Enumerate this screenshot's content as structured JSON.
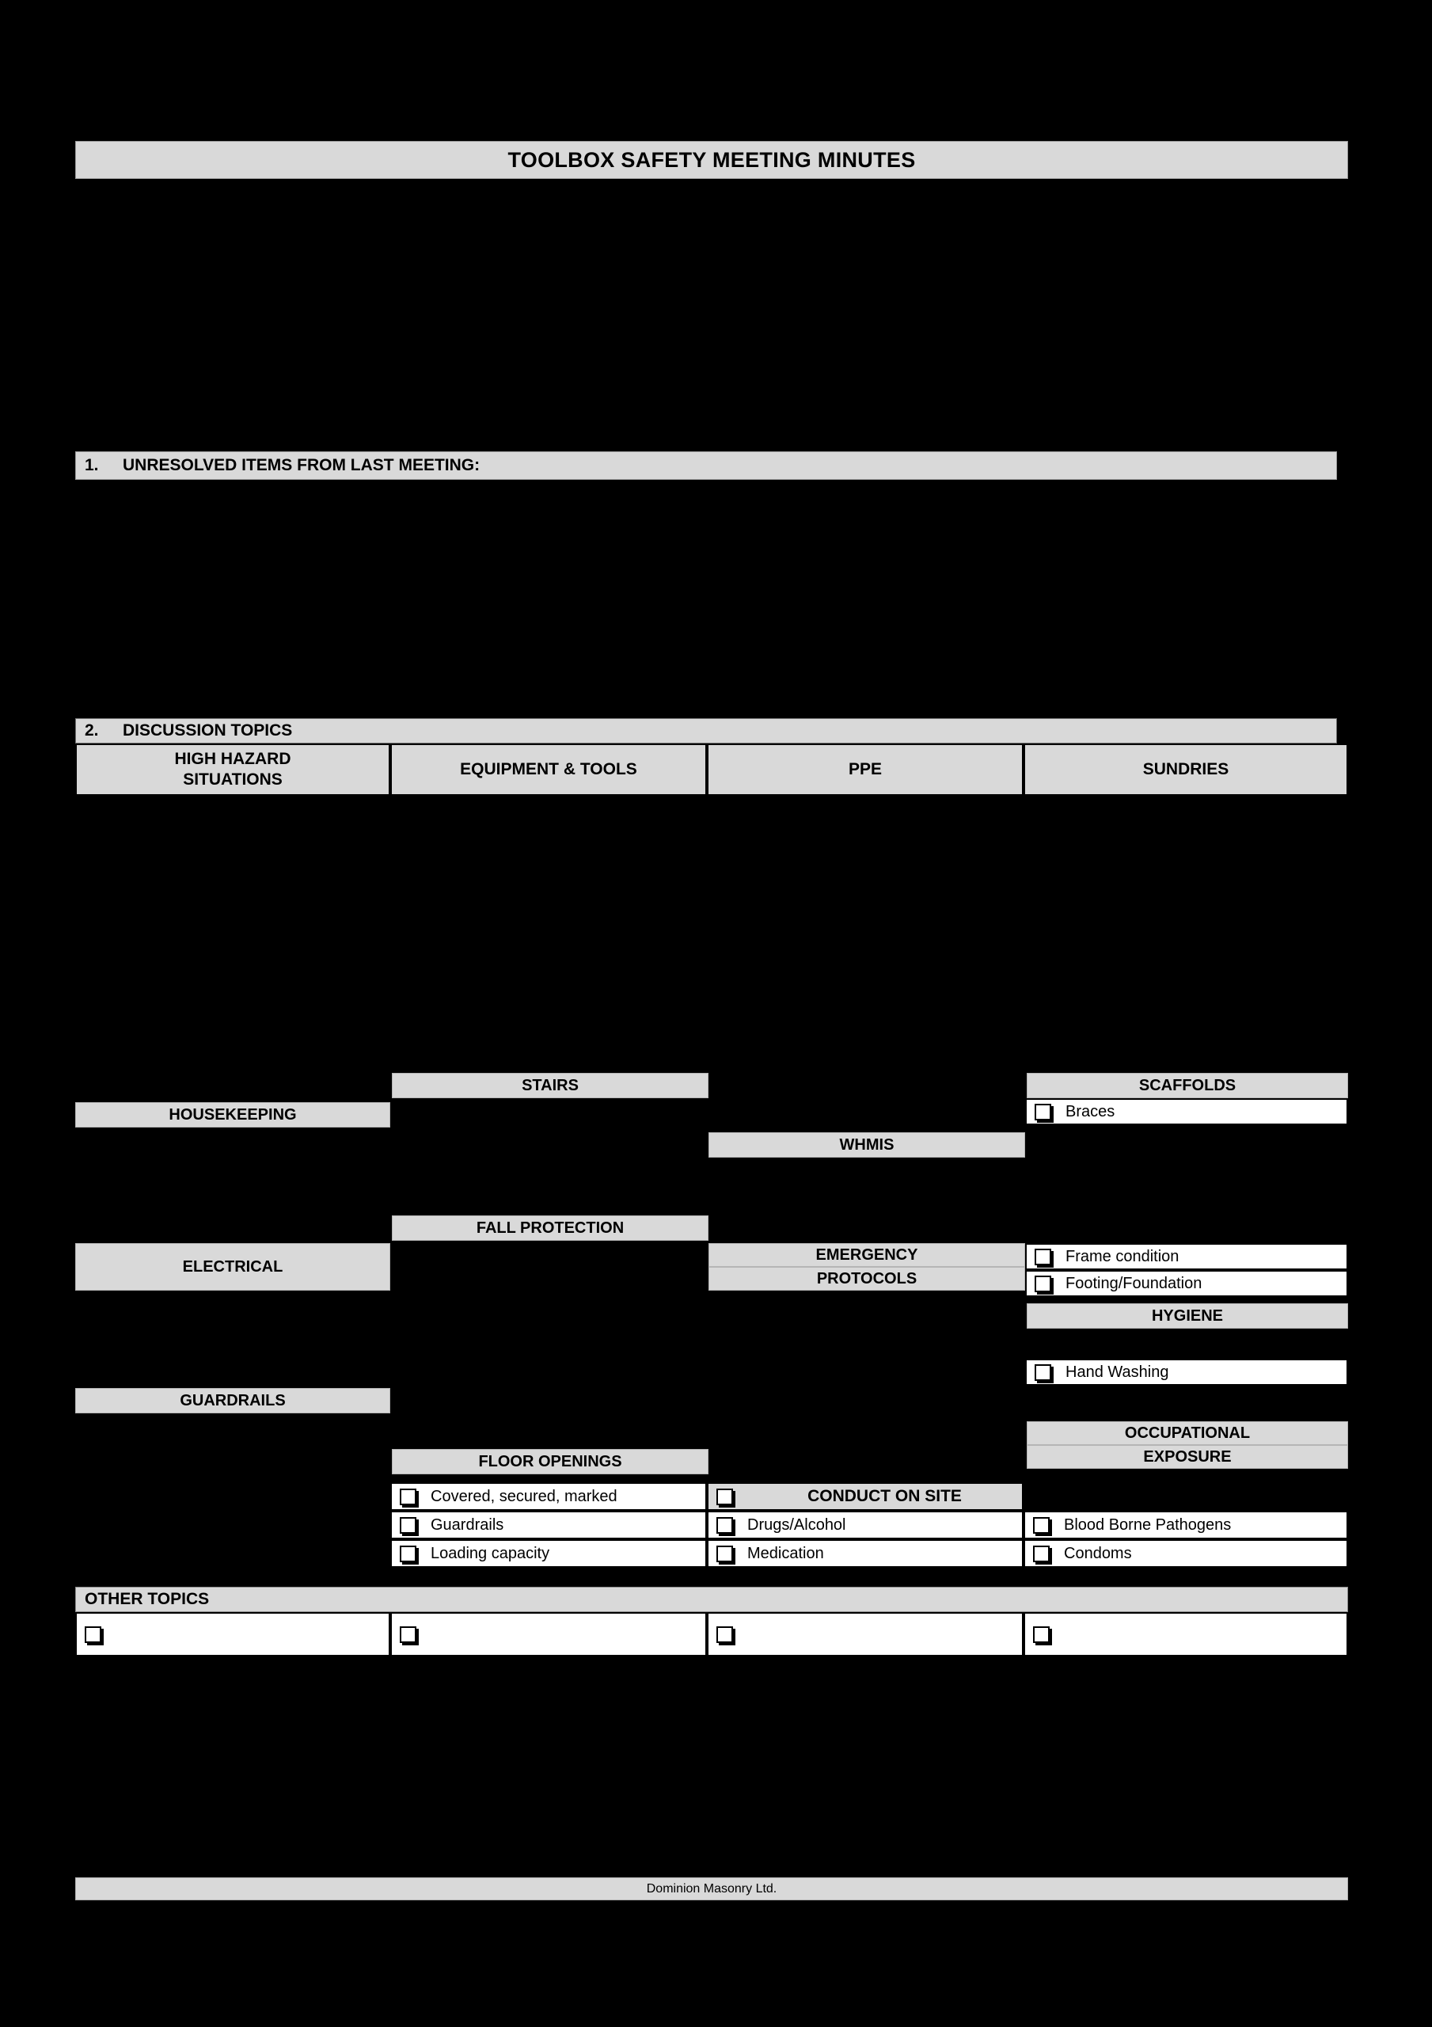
{
  "document": {
    "title": "TOOLBOX SAFETY MEETING MINUTES",
    "footer": "Dominion Masonry Ltd.",
    "accent_gray": "#d9d9d9",
    "page_background": "#000000"
  },
  "sections": {
    "unresolved": {
      "number": "1.",
      "label": "UNRESOLVED ITEMS FROM LAST MEETING:"
    },
    "discussion": {
      "number": "2.",
      "label": "DISCUSSION TOPICS"
    },
    "other_topics": {
      "label": "OTHER TOPICS"
    }
  },
  "columns": [
    {
      "header": "HIGH HAZARD\nSITUATIONS",
      "header_line1": "HIGH HAZARD",
      "header_line2": "SITUATIONS"
    },
    {
      "header": "EQUIPMENT & TOOLS",
      "header_line1": "EQUIPMENT & TOOLS",
      "header_line2": ""
    },
    {
      "header": "PPE",
      "header_line1": "PPE",
      "header_line2": ""
    },
    {
      "header": "SUNDRIES",
      "header_line1": "SUNDRIES",
      "header_line2": ""
    }
  ],
  "categories": {
    "stairs": "STAIRS",
    "housekeeping": "HOUSEKEEPING",
    "whmis": "WHMIS",
    "scaffolds": "SCAFFOLDS",
    "fall_protection": "FALL PROTECTION",
    "electrical": "ELECTRICAL",
    "emergency_protocols_line1": "EMERGENCY",
    "emergency_protocols_line2": "PROTOCOLS",
    "hygiene": "HYGIENE",
    "guardrails": "GUARDRAILS",
    "floor_openings": "FLOOR OPENINGS",
    "occupational_exposure_line1": "OCCUPATIONAL",
    "occupational_exposure_line2": "EXPOSURE"
  },
  "checklist": {
    "scaffolds": [
      {
        "label": "Braces",
        "checked": false
      },
      {
        "label": "Frame condition",
        "checked": false
      },
      {
        "label": "Footing/Foundation",
        "checked": false
      }
    ],
    "hygiene": [
      {
        "label": "Hand Washing",
        "checked": false
      }
    ],
    "floor_openings": [
      {
        "label": "Covered, secured, marked",
        "checked": false
      },
      {
        "label": "Guardrails",
        "checked": false
      },
      {
        "label": "Loading capacity",
        "checked": false
      }
    ],
    "conduct_on_site": [
      {
        "label": "CONDUCT ON SITE",
        "checked": false,
        "emphasis": true
      },
      {
        "label": "Drugs/Alcohol",
        "checked": false
      },
      {
        "label": "Medication",
        "checked": false
      }
    ],
    "occupational_exposure": [
      {
        "label": "Blood Borne Pathogens",
        "checked": false
      },
      {
        "label": "Condoms",
        "checked": false
      }
    ],
    "other_topics": [
      {
        "label": "",
        "checked": false
      },
      {
        "label": "",
        "checked": false
      },
      {
        "label": "",
        "checked": false
      },
      {
        "label": "",
        "checked": false
      }
    ]
  }
}
